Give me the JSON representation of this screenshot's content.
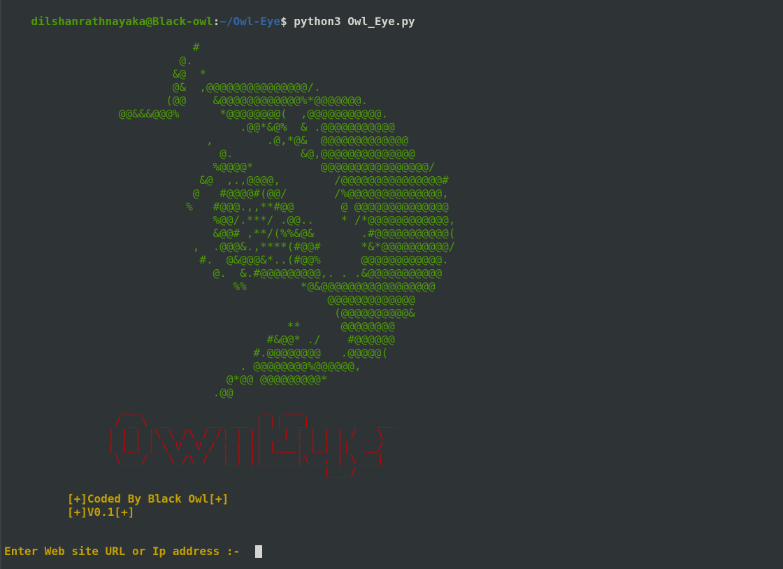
{
  "prompt": {
    "user_host": "dilshanrathnayaka@Black-owl",
    "separator": ":",
    "path": "~/Owl-Eye",
    "symbol": "$ ",
    "command": "python3 Owl_Eye.py"
  },
  "owl_art": "                            #\n                          @.\n                         &@  *\n                         @&  ,@@@@@@@@@@@@@@@/.\n                        (@@    &@@@@@@@@@@@@%*@@@@@@@.\n                 @@&&&@@@%      *@@@@@@@@(  ,@@@@@@@@@@@.\n                                   .@@*&@%  & .@@@@@@@@@@@\n                              ,        .@,*@&  @@@@@@@@@@@@@\n                                @.          &@,@@@@@@@@@@@@@@\n                               %@@@@*          @@@@@@@@@@@@@@@@/\n                             &@  ,.,@@@@,        /@@@@@@@@@@@@@@@#\n                            @   #@@@@#(@@/       /%@@@@@@@@@@@@@@,\n                           %   #@@@.,,**#@@       @ @@@@@@@@@@@@@@\n                               %@@/.***/ .@@..    * /*@@@@@@@@@@@@,\n                               &@@# ,**/(%%&@&       .#@@@@@@@@@@@(\n                            ,  .@@@&.,****(#@@#      *&*@@@@@@@@@@/\n                             #.  @&@@@&*..(#@@%      @@@@@@@@@@@@.\n                               @.  &.#@@@@@@@@@,. . .&@@@@@@@@@@@\n                                  %%        *@&@@@@@@@@@@@@@@@@@\n                                                @@@@@@@@@@@@@\n                                                 (@@@@@@@@@@&\n                                          **      @@@@@@@@\n                                       #&@@* ./    #@@@@@@\n                                     #.@@@@@@@@   .@@@@@(\n                                   . @@@@@@@@%@@@@@@,\n                                 @*@@ @@@@@@@@@*\n                               .@@",
  "logo_art": "  ___                  _  ___\n / _ \\ __      __ ___ | ||  _|  _   _   ___\n| | | |\\ \\ /\\ / /| | ||  _| | | | | / _ \\\n| |_| | \\ V  V / | | || |___| |_| ||  __/\n \\___/   \\_/\\_/  |_| ||_____|\\__, | \\___|\n                                |___/",
  "credits": {
    "line1": "[+]Coded By Black Owl[+]",
    "line2": "[+]V0.1[+]"
  },
  "input": {
    "label": "Enter Web site URL or Ip address :- ",
    "value": ""
  },
  "colors": {
    "background": "#2e3436",
    "prompt_user": "#4e9a06",
    "prompt_path": "#3465a4",
    "owl_art": "#4e9a06",
    "logo": "#cc0000",
    "credits": "#c4a000"
  }
}
